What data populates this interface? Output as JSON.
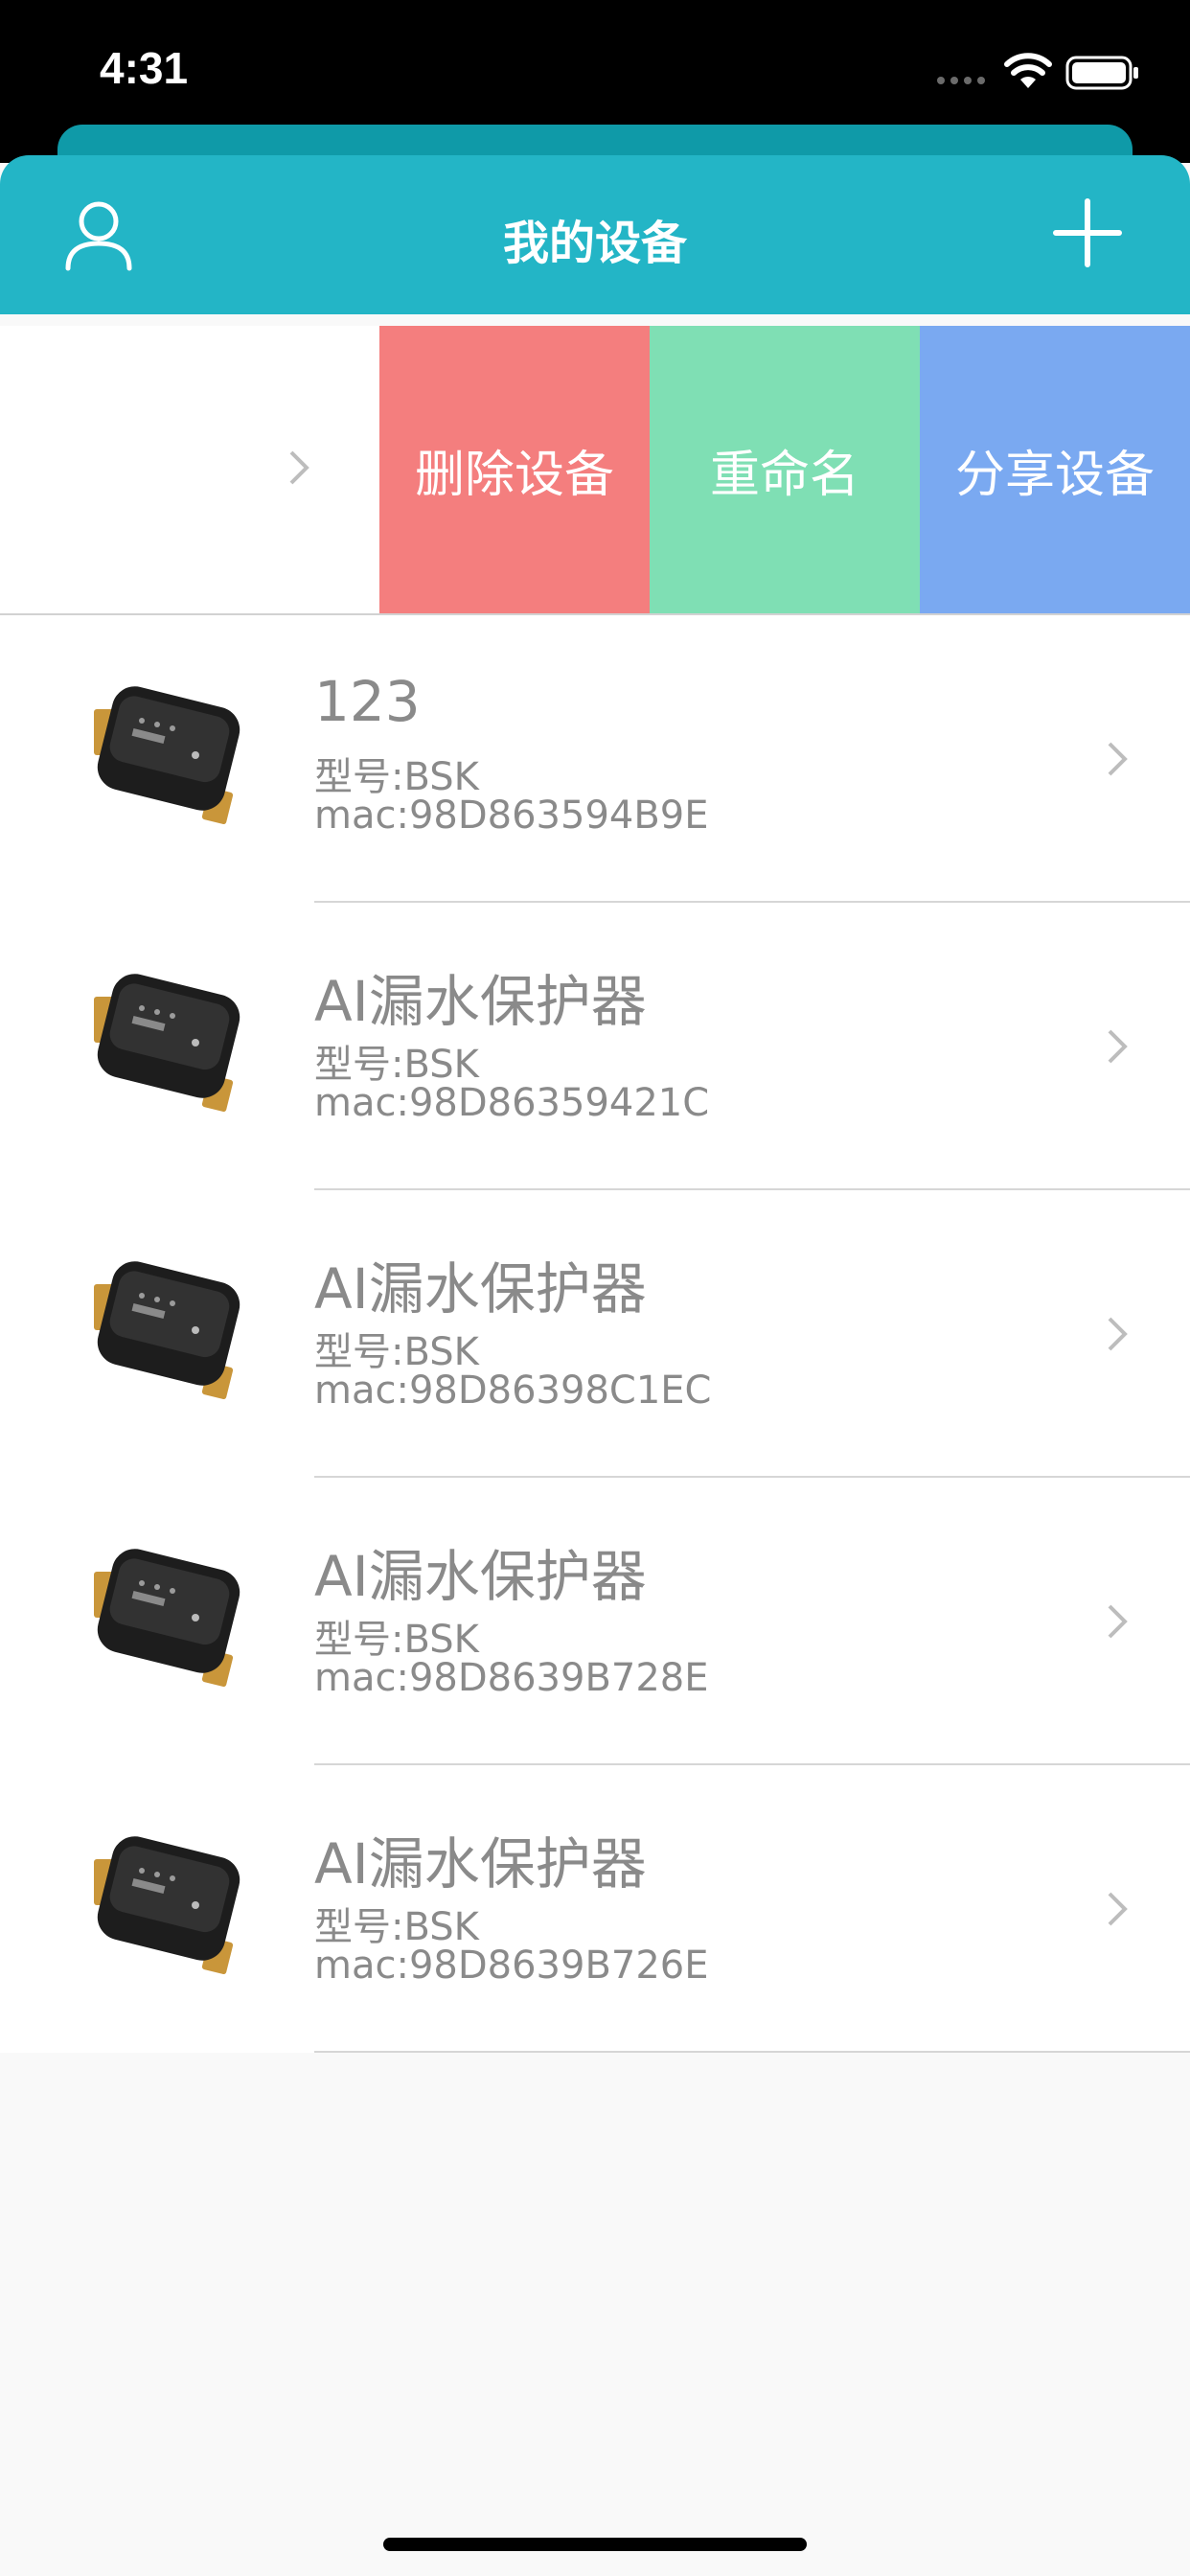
{
  "status_bar": {
    "time": "4:31"
  },
  "nav": {
    "title": "我的设备"
  },
  "swipe_actions": {
    "delete": "删除设备",
    "rename": "重命名",
    "share": "分享设备"
  },
  "devices": [
    {
      "name": "123",
      "model": "型号:BSK",
      "mac": "mac:98D863594B9E"
    },
    {
      "name": "AI漏水保护器",
      "model": "型号:BSK",
      "mac": "mac:98D86359421C"
    },
    {
      "name": "AI漏水保护器",
      "model": "型号:BSK",
      "mac": "mac:98D86398C1EC"
    },
    {
      "name": "AI漏水保护器",
      "model": "型号:BSK",
      "mac": "mac:98D8639B728E"
    },
    {
      "name": "AI漏水保护器",
      "model": "型号:BSK",
      "mac": "mac:98D8639B726E"
    }
  ],
  "icons": {
    "user": "user-icon",
    "add": "plus-icon",
    "chevron": "chevron-right-icon",
    "device": "device-thumbnail"
  },
  "colors": {
    "nav": "#23b5c6",
    "delete": "#f47e7e",
    "rename": "#7fdfb4",
    "share": "#7aa9f1"
  }
}
